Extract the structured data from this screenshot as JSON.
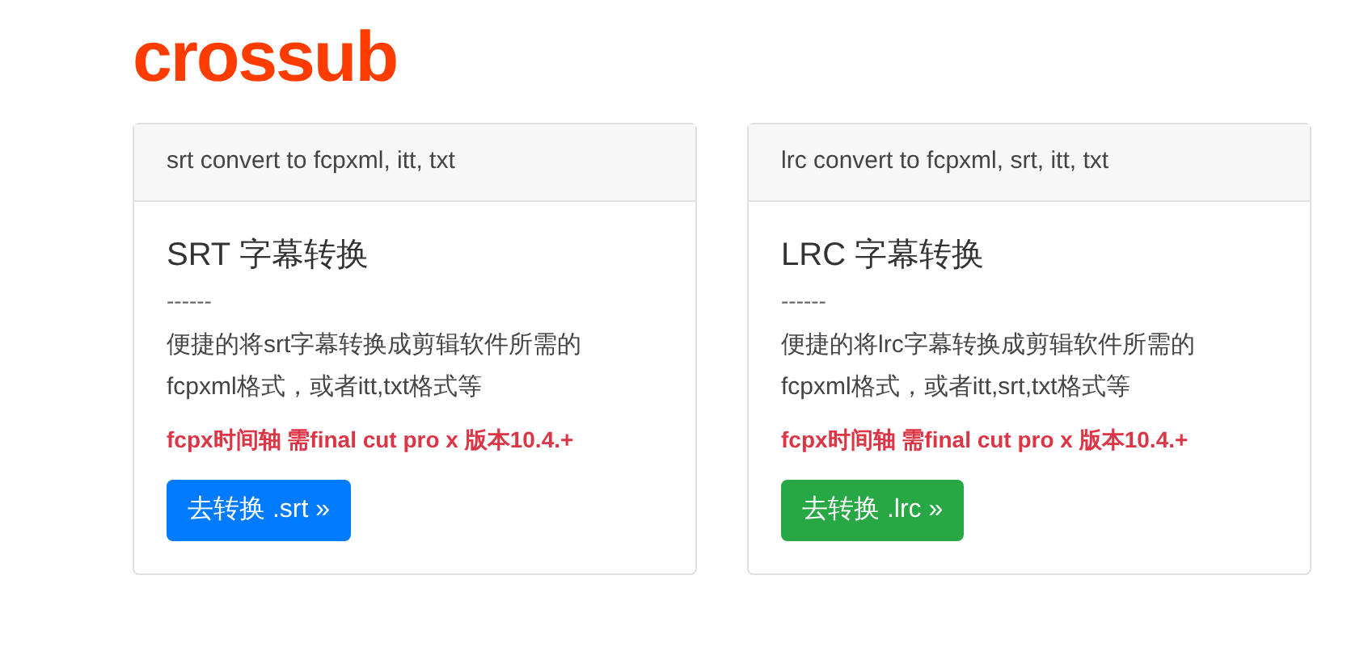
{
  "logo": "crossub",
  "cards": [
    {
      "header": "srt convert to fcpxml, itt, txt",
      "title": "SRT 字幕转换",
      "divider": "------",
      "description": "便捷的将srt字幕转换成剪辑软件所需的fcpxml格式，或者itt,txt格式等",
      "note": "fcpx时间轴 需final cut pro x 版本10.4.+",
      "button": {
        "label": "去转换 .srt »",
        "color": "#007bff"
      }
    },
    {
      "header": "lrc convert to fcpxml, srt, itt, txt",
      "title": "LRC 字幕转换",
      "divider": "------",
      "description": "便捷的将lrc字幕转换成剪辑软件所需的fcpxml格式，或者itt,srt,txt格式等",
      "note": "fcpx时间轴 需final cut pro x 版本10.4.+",
      "button": {
        "label": "去转换 .lrc »",
        "color": "#28a745"
      }
    }
  ]
}
